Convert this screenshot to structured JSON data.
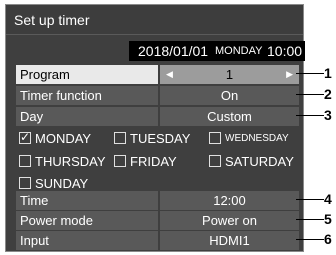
{
  "window": {
    "title": "Set up timer"
  },
  "datetime": {
    "date": "2018/01/01",
    "weekday": "MONDAY",
    "time": "10:00"
  },
  "rows": {
    "program": {
      "label": "Program",
      "value": "1",
      "left_arrow": "◀",
      "right_arrow": "▶"
    },
    "timer_function": {
      "label": "Timer function",
      "value": "On"
    },
    "day": {
      "label": "Day",
      "value": "Custom"
    },
    "time": {
      "label": "Time",
      "value": "12:00"
    },
    "power_mode": {
      "label": "Power mode",
      "value": "Power on"
    },
    "input": {
      "label": "Input",
      "value": "HDMI1"
    }
  },
  "days": {
    "monday": {
      "label": "MONDAY",
      "checked": true,
      "check_glyph": "✓"
    },
    "tuesday": {
      "label": "TUESDAY",
      "checked": false
    },
    "wednesday": {
      "label": "WEDNESDAY",
      "checked": false
    },
    "thursday": {
      "label": "THURSDAY",
      "checked": false
    },
    "friday": {
      "label": "FRIDAY",
      "checked": false
    },
    "saturday": {
      "label": "SATURDAY",
      "checked": false
    },
    "sunday": {
      "label": "SUNDAY",
      "checked": false
    }
  },
  "callouts": [
    "1",
    "2",
    "3",
    "4",
    "5",
    "6"
  ],
  "colors": {
    "panel_bg": "#3f3f3f",
    "row_bg": "#595959",
    "selected_label_bg": "#e9e9e9",
    "selected_value_bg": "#9c9c9c",
    "date_bar_bg": "#000000"
  }
}
